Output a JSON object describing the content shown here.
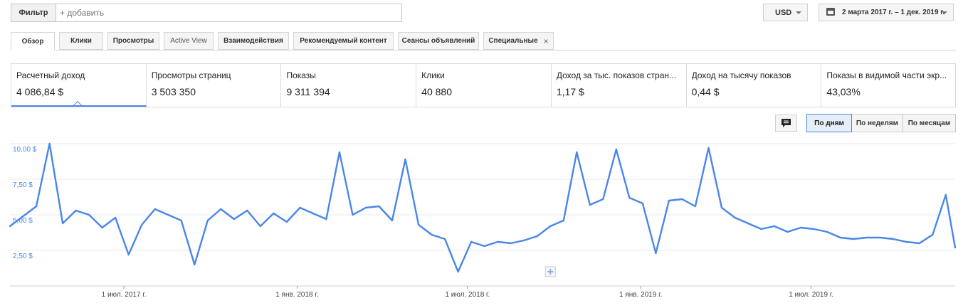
{
  "toolbar": {
    "filter_label": "Фильтр",
    "filter_placeholder": "+ добавить",
    "currency": "USD",
    "date_range": "2 марта 2017 г. – 1 дек. 2019 г."
  },
  "tabs": [
    {
      "label": "Обзор"
    },
    {
      "label": "Клики"
    },
    {
      "label": "Просмотры"
    },
    {
      "label": "Active View"
    },
    {
      "label": "Взаимодействия"
    },
    {
      "label": "Рекомендуемый контент"
    },
    {
      "label": "Сеансы объявлений"
    },
    {
      "label": "Специальные"
    }
  ],
  "metrics": [
    {
      "label": "Расчетный доход",
      "value": "4 086,84 $"
    },
    {
      "label": "Просмотры страниц",
      "value": "3 503 350"
    },
    {
      "label": "Показы",
      "value": "9 311 394"
    },
    {
      "label": "Клики",
      "value": "40 880"
    },
    {
      "label": "Доход за тыс. показов стран...",
      "value": "1,17 $"
    },
    {
      "label": "Доход на тысячу показов",
      "value": "0,44 $"
    },
    {
      "label": "Показы в видимой части экр...",
      "value": "43,03%"
    }
  ],
  "granularity": {
    "options": [
      "По дням",
      "По неделям",
      "По месяцам"
    ],
    "selected": "По дням"
  },
  "icons": {
    "comment": "comment-icon",
    "calendar": "calendar-icon",
    "close": "close-icon",
    "annotation": "add-annotation-icon"
  },
  "colors": {
    "series": "#4a86e8",
    "grid": "#e8e8e8",
    "y_tick": "#4a86e8",
    "selected_border": "#4a86e8"
  },
  "chart_data": {
    "type": "line",
    "x_range": [
      "2017-03-02",
      "2019-12-01"
    ],
    "y_ticks": [
      {
        "value": 2.5,
        "label": "2,50 $"
      },
      {
        "value": 5.0,
        "label": "5,00 $"
      },
      {
        "value": 7.5,
        "label": "7,50 $"
      },
      {
        "value": 10.0,
        "label": "10,00 $"
      }
    ],
    "x_ticks": [
      {
        "date": "2017-07-01",
        "label": "1 июл. 2017 г."
      },
      {
        "date": "2018-01-01",
        "label": "1 янв. 2018 г."
      },
      {
        "date": "2018-07-01",
        "label": "1 июл. 2018 г."
      },
      {
        "date": "2019-01-01",
        "label": "1 янв. 2019 г."
      },
      {
        "date": "2019-07-01",
        "label": "1 июл. 2019 г."
      }
    ],
    "ylim": [
      0,
      10.0
    ],
    "series": [
      {
        "values": [
          {
            "date": "2017-03-02",
            "value": 4.2
          },
          {
            "date": "2017-03-16",
            "value": 4.9
          },
          {
            "date": "2017-03-30",
            "value": 5.6
          },
          {
            "date": "2017-04-13",
            "value": 10.0
          },
          {
            "date": "2017-04-27",
            "value": 4.4
          },
          {
            "date": "2017-05-11",
            "value": 5.3
          },
          {
            "date": "2017-05-25",
            "value": 5.0
          },
          {
            "date": "2017-06-08",
            "value": 4.1
          },
          {
            "date": "2017-06-22",
            "value": 4.8
          },
          {
            "date": "2017-07-06",
            "value": 2.2
          },
          {
            "date": "2017-07-20",
            "value": 4.3
          },
          {
            "date": "2017-08-03",
            "value": 5.4
          },
          {
            "date": "2017-08-17",
            "value": 5.0
          },
          {
            "date": "2017-08-31",
            "value": 4.6
          },
          {
            "date": "2017-09-14",
            "value": 1.5
          },
          {
            "date": "2017-09-28",
            "value": 4.6
          },
          {
            "date": "2017-10-12",
            "value": 5.4
          },
          {
            "date": "2017-10-26",
            "value": 4.7
          },
          {
            "date": "2017-11-09",
            "value": 5.3
          },
          {
            "date": "2017-11-23",
            "value": 4.2
          },
          {
            "date": "2017-12-07",
            "value": 5.1
          },
          {
            "date": "2017-12-21",
            "value": 4.5
          },
          {
            "date": "2018-01-04",
            "value": 5.5
          },
          {
            "date": "2018-01-18",
            "value": 5.1
          },
          {
            "date": "2018-02-01",
            "value": 4.7
          },
          {
            "date": "2018-02-15",
            "value": 9.4
          },
          {
            "date": "2018-03-01",
            "value": 5.0
          },
          {
            "date": "2018-03-15",
            "value": 5.5
          },
          {
            "date": "2018-03-29",
            "value": 5.6
          },
          {
            "date": "2018-04-12",
            "value": 4.6
          },
          {
            "date": "2018-04-26",
            "value": 8.9
          },
          {
            "date": "2018-05-10",
            "value": 4.3
          },
          {
            "date": "2018-05-24",
            "value": 3.6
          },
          {
            "date": "2018-06-07",
            "value": 3.3
          },
          {
            "date": "2018-06-21",
            "value": 1.0
          },
          {
            "date": "2018-07-05",
            "value": 3.1
          },
          {
            "date": "2018-07-19",
            "value": 2.8
          },
          {
            "date": "2018-08-02",
            "value": 3.1
          },
          {
            "date": "2018-08-16",
            "value": 3.0
          },
          {
            "date": "2018-08-30",
            "value": 3.2
          },
          {
            "date": "2018-09-13",
            "value": 3.5
          },
          {
            "date": "2018-09-27",
            "value": 4.2
          },
          {
            "date": "2018-10-11",
            "value": 4.6
          },
          {
            "date": "2018-10-25",
            "value": 9.4
          },
          {
            "date": "2018-11-08",
            "value": 5.7
          },
          {
            "date": "2018-11-22",
            "value": 6.1
          },
          {
            "date": "2018-12-06",
            "value": 9.6
          },
          {
            "date": "2018-12-20",
            "value": 6.2
          },
          {
            "date": "2019-01-03",
            "value": 5.8
          },
          {
            "date": "2019-01-17",
            "value": 2.3
          },
          {
            "date": "2019-01-31",
            "value": 6.0
          },
          {
            "date": "2019-02-14",
            "value": 6.1
          },
          {
            "date": "2019-02-28",
            "value": 5.6
          },
          {
            "date": "2019-03-14",
            "value": 9.7
          },
          {
            "date": "2019-03-28",
            "value": 5.5
          },
          {
            "date": "2019-04-11",
            "value": 4.8
          },
          {
            "date": "2019-04-25",
            "value": 4.4
          },
          {
            "date": "2019-05-09",
            "value": 4.0
          },
          {
            "date": "2019-05-23",
            "value": 4.2
          },
          {
            "date": "2019-06-06",
            "value": 3.8
          },
          {
            "date": "2019-06-20",
            "value": 4.1
          },
          {
            "date": "2019-07-04",
            "value": 4.0
          },
          {
            "date": "2019-07-18",
            "value": 3.8
          },
          {
            "date": "2019-08-01",
            "value": 3.4
          },
          {
            "date": "2019-08-15",
            "value": 3.3
          },
          {
            "date": "2019-08-29",
            "value": 3.4
          },
          {
            "date": "2019-09-12",
            "value": 3.4
          },
          {
            "date": "2019-09-26",
            "value": 3.3
          },
          {
            "date": "2019-10-10",
            "value": 3.1
          },
          {
            "date": "2019-10-24",
            "value": 3.0
          },
          {
            "date": "2019-11-07",
            "value": 3.6
          },
          {
            "date": "2019-11-21",
            "value": 6.4
          },
          {
            "date": "2019-12-01",
            "value": 2.7
          }
        ]
      }
    ]
  }
}
